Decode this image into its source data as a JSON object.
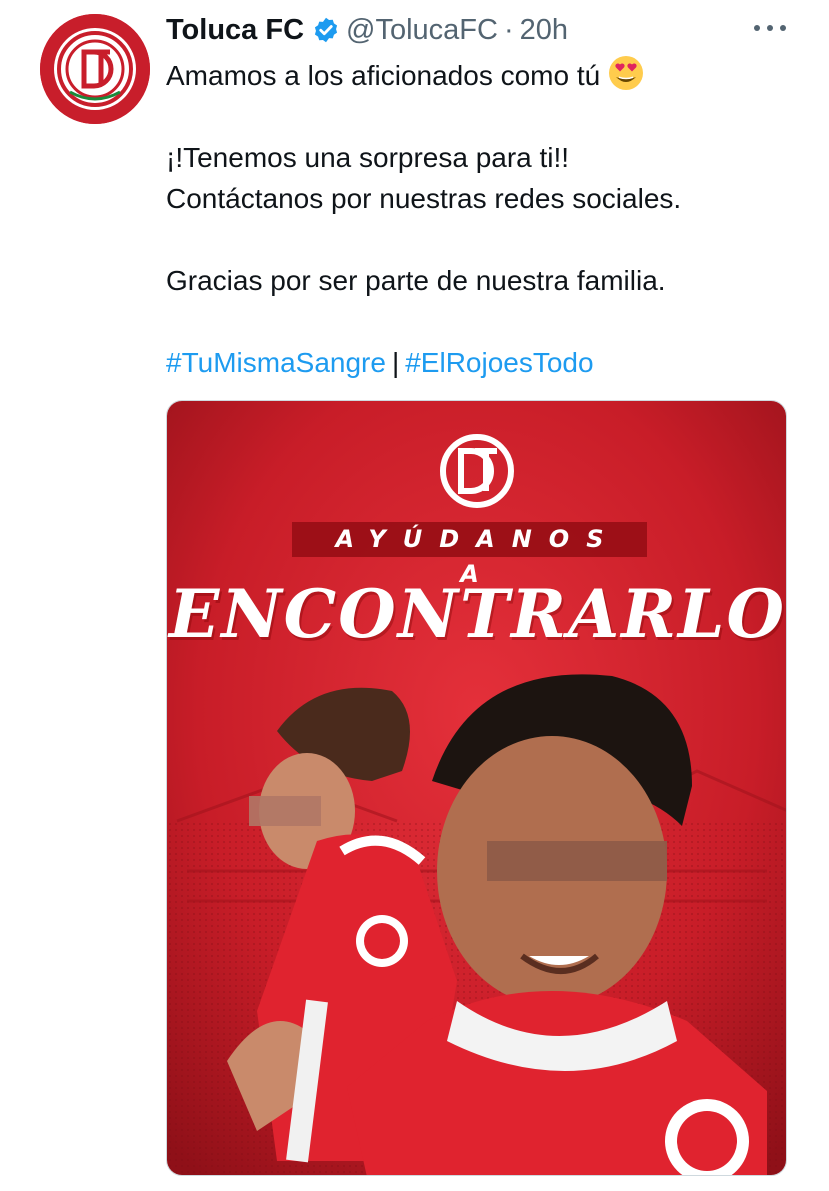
{
  "tweet": {
    "author_name": "Toluca FC",
    "handle": "@TolucaFC",
    "separator": "·",
    "time": "20h",
    "lines": {
      "line1": "Amamos a los aficionados como tú",
      "line2": "¡!Tenemos una sorpresa para ti!!",
      "line3": "Contáctanos por nuestras redes sociales.",
      "line4": "Gracias por ser parte de nuestra familia."
    },
    "emoji": "smiling-face-with-heart-eyes",
    "hashtags": [
      "#TuMismaSangre",
      "#ElRojoesTodo"
    ],
    "hashtag_separator": "|"
  },
  "media": {
    "banner_text": "AYÚDANOS A",
    "title_text": "ENCONTRARLO"
  },
  "colors": {
    "brand_red": "#d11f2d",
    "link_blue": "#1d9bf0",
    "verified_blue": "#1d9bf0",
    "text_primary": "#0f1419",
    "text_secondary": "#536471"
  },
  "icons": [
    "verified-badge-icon",
    "more-options-icon",
    "club-crest-icon",
    "heart-eyes-emoji-icon"
  ]
}
